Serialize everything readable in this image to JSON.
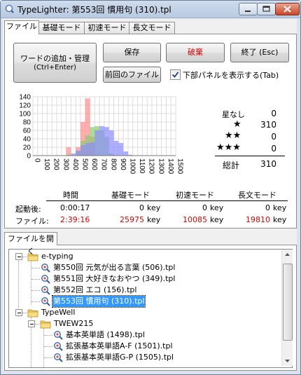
{
  "window": {
    "title": "TypeLighter: 第553回 慣用句 (310).tpl"
  },
  "tabs": [
    {
      "label": "ファイル",
      "active": true
    },
    {
      "label": "基礎モード",
      "active": false
    },
    {
      "label": "初速モード",
      "active": false
    },
    {
      "label": "長文モード",
      "active": false
    }
  ],
  "buttons": {
    "add_manage_line1": "ワードの追加・管理",
    "add_manage_line2": "(Ctrl+Enter)",
    "save": "保存",
    "discard": "破棄",
    "exit": "終了 (Esc)",
    "prev_file": "前回のファイル"
  },
  "show_panel": {
    "label": "下部パネルを表示する(Tab)",
    "checked": true
  },
  "stars": {
    "rows": [
      {
        "label": "星なし",
        "value": "0"
      },
      {
        "label": "★",
        "value": "310"
      },
      {
        "label": "★★",
        "value": "0"
      },
      {
        "label": "★★★",
        "value": "0"
      }
    ],
    "total_label": "総計",
    "total_value": "310"
  },
  "chart_data": {
    "type": "bar",
    "x": [
      0,
      50,
      100,
      150,
      200,
      250,
      300,
      350,
      400,
      450,
      500,
      550,
      600,
      650,
      700,
      750,
      800,
      850,
      900,
      950,
      1000,
      1050,
      1100,
      1150,
      1200,
      1250,
      1300,
      1350,
      1400,
      1450,
      1500
    ],
    "xticks": [
      "0",
      "100",
      "200",
      "300",
      "400",
      "500",
      "600",
      "700",
      "800",
      "900",
      "1000",
      "1100",
      "1200",
      "1300",
      "1400",
      "1500"
    ],
    "yticks": [
      "0",
      "20",
      "40",
      "60",
      "80",
      "100",
      "120",
      "140"
    ],
    "ylim": [
      0,
      140
    ],
    "xlim": [
      0,
      1500
    ],
    "grid": true,
    "bin_width": 50,
    "series": [
      {
        "color": "#ff8c8c",
        "bins": [
          [
            350,
            20
          ],
          [
            400,
            0
          ],
          [
            450,
            20
          ],
          [
            500,
            80
          ],
          [
            550,
            136
          ],
          [
            600,
            45
          ],
          [
            650,
            0
          ]
        ]
      },
      {
        "color": "#8ccc6e",
        "bins": [
          [
            350,
            2
          ],
          [
            400,
            0
          ],
          [
            450,
            10
          ],
          [
            500,
            35
          ],
          [
            550,
            48
          ],
          [
            600,
            68
          ],
          [
            650,
            70
          ],
          [
            700,
            60
          ],
          [
            750,
            45
          ],
          [
            800,
            5
          ]
        ]
      },
      {
        "color": "#8c8cff",
        "bins": [
          [
            400,
            5
          ],
          [
            450,
            12
          ],
          [
            500,
            25
          ],
          [
            550,
            30
          ],
          [
            600,
            32
          ],
          [
            650,
            60
          ],
          [
            700,
            70
          ],
          [
            750,
            68
          ],
          [
            800,
            60
          ],
          [
            850,
            35
          ],
          [
            900,
            30
          ],
          [
            950,
            10
          ],
          [
            1000,
            2
          ]
        ]
      }
    ]
  },
  "table": {
    "headers": [
      "時間",
      "基礎モード",
      "初速モード",
      "長文モード"
    ],
    "rows": [
      {
        "label": "起動後:",
        "time": "0:00:17",
        "basic": "0",
        "initial": "0",
        "long": "0",
        "unit": "key",
        "red": false
      },
      {
        "label": "ファイル:",
        "time": "2:39:16",
        "basic": "25975",
        "initial": "10085",
        "long": "19810",
        "unit": "key",
        "red": true
      }
    ]
  },
  "file_group": {
    "tab_label": "ファイルを開く"
  },
  "tree": {
    "items": [
      {
        "label": "e-typing"
      },
      {
        "label": "第550回 元気が出る言葉 (506).tpl"
      },
      {
        "label": "第551回 大好きなおやつ (349).tpl"
      },
      {
        "label": "第552回 エコ (156).tpl"
      },
      {
        "label": "第553回 慣用句 (310).tpl",
        "selected": true
      },
      {
        "label": "TypeWell"
      },
      {
        "label": "TWEW215"
      },
      {
        "label": "基本英単語 (1498).tpl"
      },
      {
        "label": "拡張基本英単語A-F (1501).tpl"
      },
      {
        "label": "拡張基本英単語G-P (1505).tpl"
      }
    ]
  }
}
